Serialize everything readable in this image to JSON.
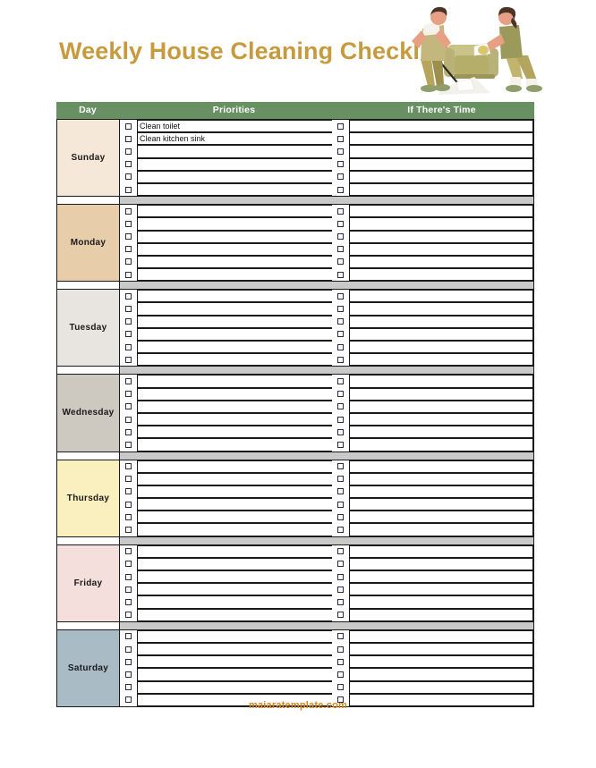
{
  "header": {
    "title": "Weekly House Cleaning Checklist",
    "illustration_name": "two-people-cleaning-illustration",
    "title_color": "#c79a3e"
  },
  "table": {
    "header_bg": "#699093",
    "header_bg_color": "#699063",
    "columns": {
      "day": "Day",
      "priorities": "Priorities",
      "if_theres_time": "If There's Time"
    },
    "rows_per_day": 6,
    "days": [
      {
        "name": "Sunday",
        "color": "#f6e8d8",
        "priorities": [
          "Clean toilet",
          "Clean kitchen sink",
          "",
          "",
          "",
          ""
        ],
        "if_theres_time": [
          "",
          "",
          "",
          "",
          "",
          ""
        ]
      },
      {
        "name": "Monday",
        "color": "#e8cdaa",
        "priorities": [
          "",
          "",
          "",
          "",
          "",
          ""
        ],
        "if_theres_time": [
          "",
          "",
          "",
          "",
          "",
          ""
        ]
      },
      {
        "name": "Tuesday",
        "color": "#e8e4df",
        "priorities": [
          "",
          "",
          "",
          "",
          "",
          ""
        ],
        "if_theres_time": [
          "",
          "",
          "",
          "",
          "",
          ""
        ]
      },
      {
        "name": "Wednesday",
        "color": "#cdc8c0",
        "priorities": [
          "",
          "",
          "",
          "",
          "",
          ""
        ],
        "if_theres_time": [
          "",
          "",
          "",
          "",
          "",
          ""
        ]
      },
      {
        "name": "Thursday",
        "color": "#faefbe",
        "priorities": [
          "",
          "",
          "",
          "",
          "",
          ""
        ],
        "if_theres_time": [
          "",
          "",
          "",
          "",
          "",
          ""
        ]
      },
      {
        "name": "Friday",
        "color": "#f5dfdc",
        "priorities": [
          "",
          "",
          "",
          "",
          "",
          ""
        ],
        "if_theres_time": [
          "",
          "",
          "",
          "",
          "",
          ""
        ]
      },
      {
        "name": "Saturday",
        "color": "#a9bcc6",
        "priorities": [
          "",
          "",
          "",
          "",
          "",
          ""
        ],
        "if_theres_time": [
          "",
          "",
          "",
          "",
          "",
          ""
        ]
      }
    ]
  },
  "footer": {
    "credit": "maiaratemplate.com",
    "credit_color": "#d2861f"
  }
}
